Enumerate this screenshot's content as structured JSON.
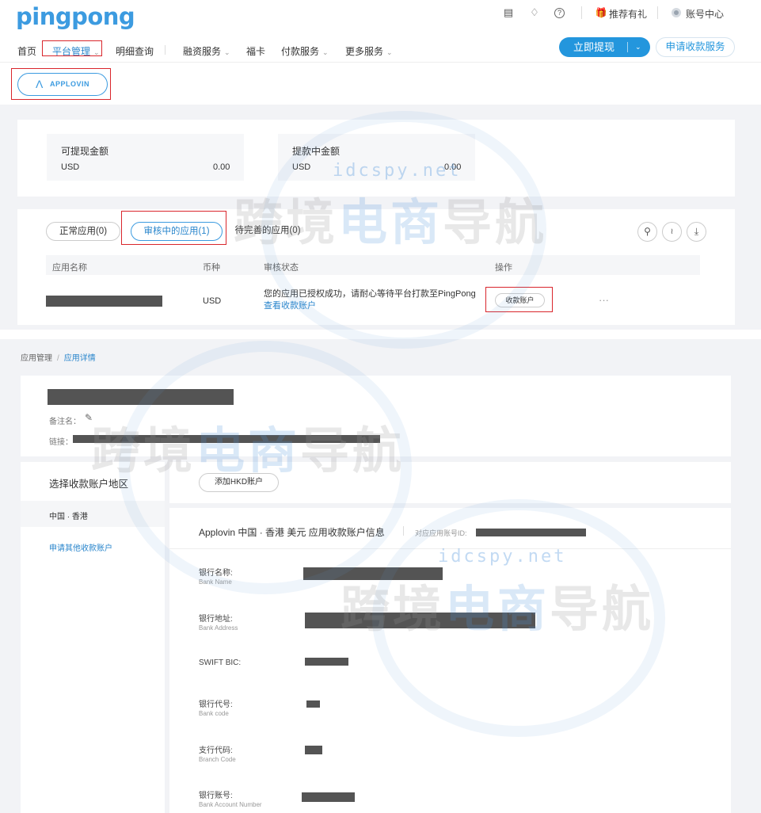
{
  "header": {
    "logo": "pingpong",
    "recommend": "推荐有礼",
    "account": "账号中心",
    "nav": [
      "首页",
      "平台管理",
      "明细查询",
      "融资服务",
      "福卡",
      "付款服务",
      "更多服务"
    ],
    "withdraw_btn": "立即提现",
    "apply_btn": "申请收款服务",
    "platform": "APPLOVIN"
  },
  "balances": [
    {
      "title": "可提现金额",
      "currency": "USD",
      "amount": "0.00"
    },
    {
      "title": "提款中金额",
      "currency": "USD",
      "amount": "0.00"
    }
  ],
  "tabs": [
    "正常应用(0)",
    "审核中的应用(1)",
    "待完善的应用(0)"
  ],
  "table": {
    "headers": [
      "应用名称",
      "币种",
      "审核状态",
      "操作"
    ],
    "row": {
      "currency": "USD",
      "status": "您的应用已授权成功，请耐心等待平台打款至PingPong",
      "status_link": "查看收款账户",
      "action": "收款账户",
      "more": "···"
    }
  },
  "detail": {
    "breadcrumb": [
      "应用管理",
      "应用详情"
    ],
    "remark_label": "备注名：",
    "link_label": "链接：",
    "region_title": "选择收款账户地区",
    "region": "中国 · 香港",
    "apply_other": "申请其他收款账户",
    "add_btn": "添加HKD账户",
    "info_title": "Applovin 中国 · 香港 美元 应用收款账户信息",
    "info_sub": "对应应用账号ID:",
    "rows": [
      {
        "cn": "银行名称:",
        "en": "Bank Name"
      },
      {
        "cn": "银行地址:",
        "en": "Bank Address"
      },
      {
        "cn": "SWIFT BIC:",
        "en": ""
      },
      {
        "cn": "银行代号:",
        "en": "Bank code"
      },
      {
        "cn": "支行代码:",
        "en": "Branch Code"
      },
      {
        "cn": "银行账号:",
        "en": "Bank Account Number"
      }
    ]
  },
  "watermark": {
    "url": "idcspy.net",
    "text_a": "跨境",
    "text_b": "电商",
    "text_c": "导航"
  }
}
